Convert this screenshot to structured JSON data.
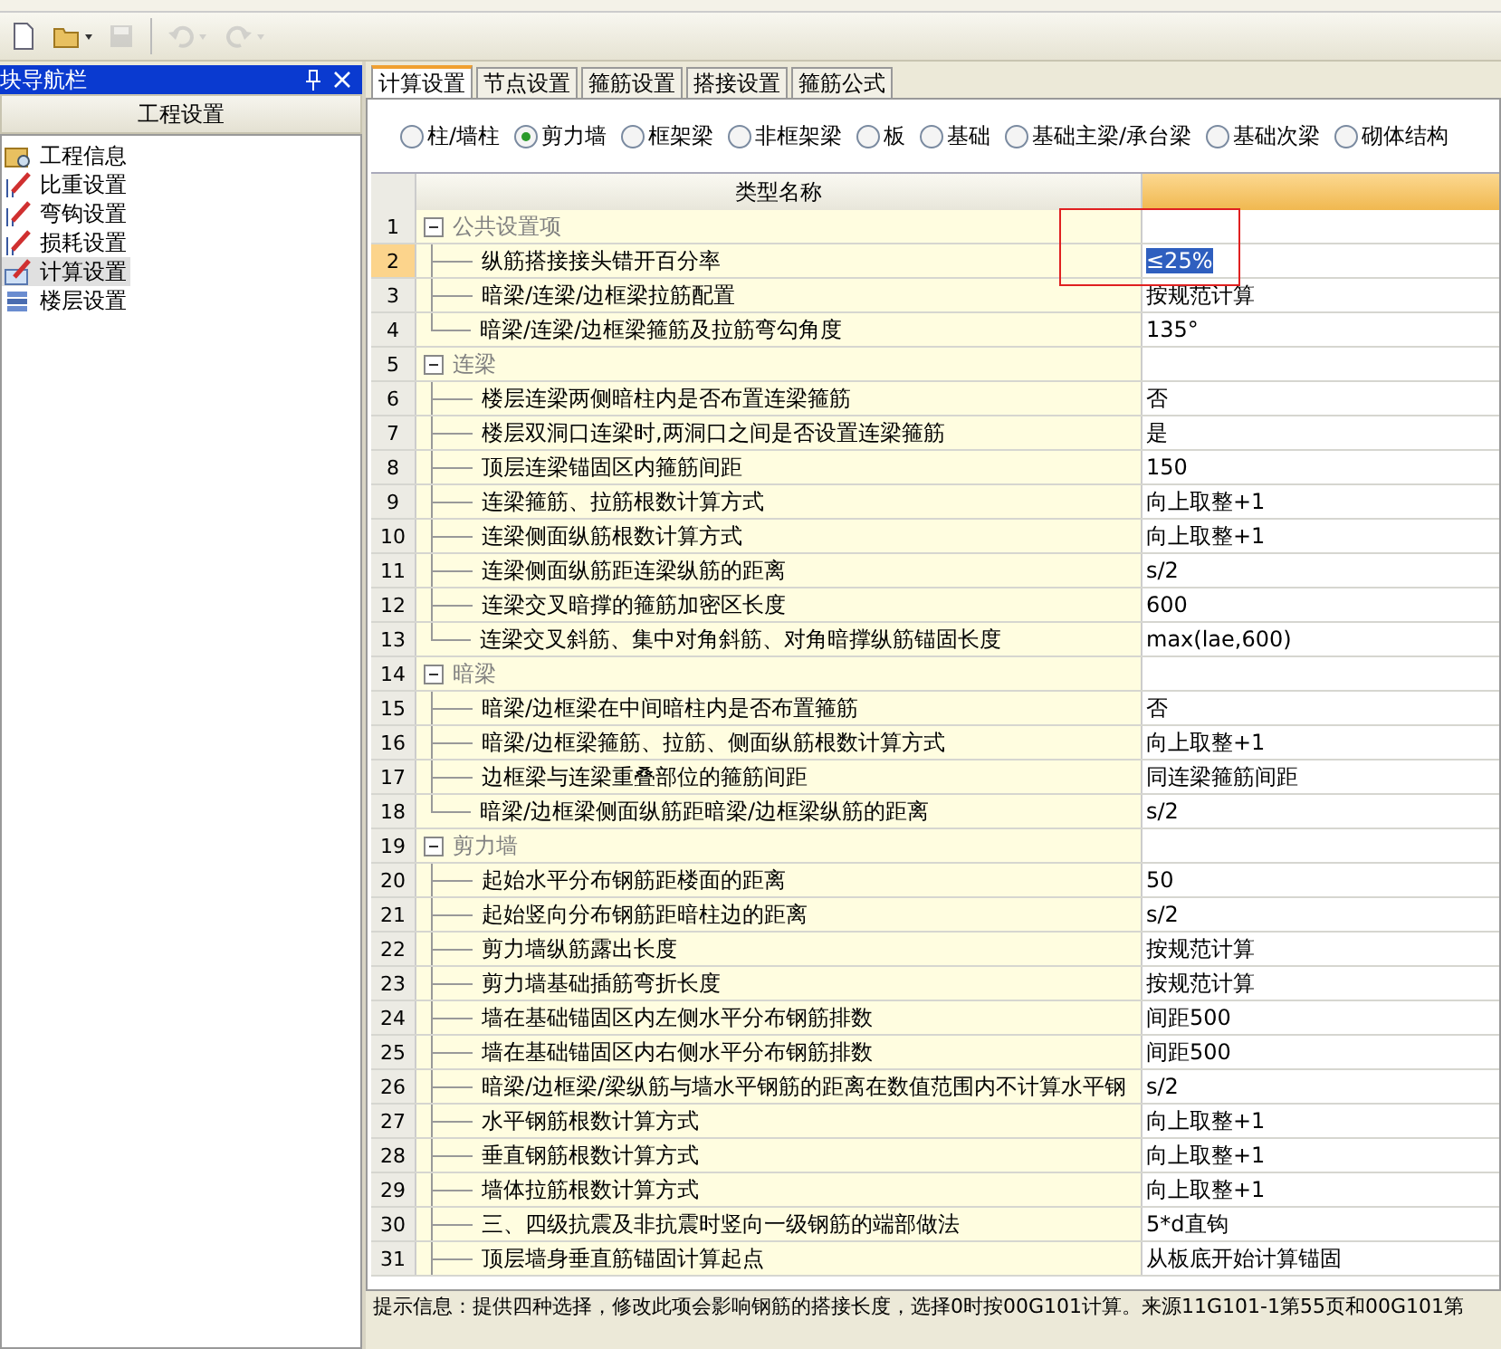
{
  "toolbar": {
    "buttons": [
      {
        "kind": "new",
        "disabled": false
      },
      {
        "kind": "open",
        "disabled": false
      },
      {
        "kind": "save",
        "disabled": true
      },
      {
        "kind": "undo",
        "disabled": true
      },
      {
        "kind": "redo",
        "disabled": true
      }
    ]
  },
  "sidebar": {
    "title": "块导航栏",
    "section": "工程设置",
    "items": [
      {
        "label": "工程信息",
        "kind": "info",
        "selected": false
      },
      {
        "label": "比重设置",
        "kind": "weight",
        "selected": false
      },
      {
        "label": "弯钩设置",
        "kind": "hook",
        "selected": false
      },
      {
        "label": "损耗设置",
        "kind": "loss",
        "selected": false
      },
      {
        "label": "计算设置",
        "kind": "calc",
        "selected": true
      },
      {
        "label": "楼层设置",
        "kind": "floor",
        "selected": false
      }
    ]
  },
  "tabs": [
    {
      "label": "计算设置",
      "selected": true
    },
    {
      "label": "节点设置",
      "selected": false
    },
    {
      "label": "箍筋设置",
      "selected": false
    },
    {
      "label": "搭接设置",
      "selected": false
    },
    {
      "label": "箍筋公式",
      "selected": false
    }
  ],
  "radios": [
    {
      "label": "柱/墙柱",
      "selected": false
    },
    {
      "label": "剪力墙",
      "selected": true
    },
    {
      "label": "框架梁",
      "selected": false
    },
    {
      "label": "非框架梁",
      "selected": false
    },
    {
      "label": "板",
      "selected": false
    },
    {
      "label": "基础",
      "selected": false
    },
    {
      "label": "基础主梁/承台梁",
      "selected": false
    },
    {
      "label": "基础次梁",
      "selected": false
    },
    {
      "label": "砌体结构",
      "selected": false
    }
  ],
  "table": {
    "columns": [
      "类型名称"
    ],
    "rows": [
      {
        "kind": "group",
        "num": "1",
        "name": "公共设置项",
        "expanded": true,
        "selected": false
      },
      {
        "kind": "item",
        "num": "2",
        "name": "纵筋搭接接头错开百分率",
        "value": "≤25%",
        "selected": true
      },
      {
        "kind": "item",
        "num": "3",
        "name": "暗梁/连梁/边框梁拉筋配置",
        "value": "按规范计算",
        "selected": false
      },
      {
        "kind": "item",
        "num": "4",
        "name": "暗梁/连梁/边框梁箍筋及拉筋弯勾角度",
        "value": "135°",
        "selected": false
      },
      {
        "kind": "group",
        "num": "5",
        "name": "连梁",
        "expanded": true,
        "selected": false
      },
      {
        "kind": "item",
        "num": "6",
        "name": "楼层连梁两侧暗柱内是否布置连梁箍筋",
        "value": "否",
        "selected": false
      },
      {
        "kind": "item",
        "num": "7",
        "name": "楼层双洞口连梁时,两洞口之间是否设置连梁箍筋",
        "value": "是",
        "selected": false
      },
      {
        "kind": "item",
        "num": "8",
        "name": "顶层连梁锚固区内箍筋间距",
        "value": "150",
        "selected": false
      },
      {
        "kind": "item",
        "num": "9",
        "name": "连梁箍筋、拉筋根数计算方式",
        "value": "向上取整+1",
        "selected": false
      },
      {
        "kind": "item",
        "num": "10",
        "name": "连梁侧面纵筋根数计算方式",
        "value": "向上取整+1",
        "selected": false
      },
      {
        "kind": "item",
        "num": "11",
        "name": "连梁侧面纵筋距连梁纵筋的距离",
        "value": "s/2",
        "selected": false
      },
      {
        "kind": "item",
        "num": "12",
        "name": "连梁交叉暗撑的箍筋加密区长度",
        "value": "600",
        "selected": false
      },
      {
        "kind": "item",
        "num": "13",
        "name": "连梁交叉斜筋、集中对角斜筋、对角暗撑纵筋锚固长度",
        "value": "max(lae,600)",
        "selected": false
      },
      {
        "kind": "group",
        "num": "14",
        "name": "暗梁",
        "expanded": true,
        "selected": false
      },
      {
        "kind": "item",
        "num": "15",
        "name": "暗梁/边框梁在中间暗柱内是否布置箍筋",
        "value": "否",
        "selected": false
      },
      {
        "kind": "item",
        "num": "16",
        "name": "暗梁/边框梁箍筋、拉筋、侧面纵筋根数计算方式",
        "value": "向上取整+1",
        "selected": false
      },
      {
        "kind": "item",
        "num": "17",
        "name": "边框梁与连梁重叠部位的箍筋间距",
        "value": "同连梁箍筋间距",
        "selected": false
      },
      {
        "kind": "item",
        "num": "18",
        "name": "暗梁/边框梁侧面纵筋距暗梁/边框梁纵筋的距离",
        "value": "s/2",
        "selected": false
      },
      {
        "kind": "group",
        "num": "19",
        "name": "剪力墙",
        "expanded": true,
        "selected": false
      },
      {
        "kind": "item",
        "num": "20",
        "name": "起始水平分布钢筋距楼面的距离",
        "value": "50",
        "selected": false
      },
      {
        "kind": "item",
        "num": "21",
        "name": "起始竖向分布钢筋距暗柱边的距离",
        "value": "s/2",
        "selected": false
      },
      {
        "kind": "item",
        "num": "22",
        "name": "剪力墙纵筋露出长度",
        "value": "按规范计算",
        "selected": false
      },
      {
        "kind": "item",
        "num": "23",
        "name": "剪力墙基础插筋弯折长度",
        "value": "按规范计算",
        "selected": false
      },
      {
        "kind": "item",
        "num": "24",
        "name": "墙在基础锚固区内左侧水平分布钢筋排数",
        "value": "间距500",
        "selected": false
      },
      {
        "kind": "item",
        "num": "25",
        "name": "墙在基础锚固区内右侧水平分布钢筋排数",
        "value": "间距500",
        "selected": false
      },
      {
        "kind": "item",
        "num": "26",
        "name": "暗梁/边框梁/梁纵筋与墙水平钢筋的距离在数值范围内不计算水平钢",
        "value": "s/2",
        "selected": false
      },
      {
        "kind": "item",
        "num": "27",
        "name": "水平钢筋根数计算方式",
        "value": "向上取整+1",
        "selected": false
      },
      {
        "kind": "item",
        "num": "28",
        "name": "垂直钢筋根数计算方式",
        "value": "向上取整+1",
        "selected": false
      },
      {
        "kind": "item",
        "num": "29",
        "name": "墙体拉筋根数计算方式",
        "value": "向上取整+1",
        "selected": false
      },
      {
        "kind": "item",
        "num": "30",
        "name": "三、四级抗震及非抗震时竖向一级钢筋的端部做法",
        "value": "5*d直钩",
        "selected": false
      },
      {
        "kind": "item",
        "num": "31",
        "name": "顶层墙身垂直筋锚固计算起点",
        "value": "从板底开始计算锚固",
        "selected": false
      }
    ]
  },
  "status_bar": "提示信息：提供四种选择，修改此项会影响钢筋的搭接长度，选择0时按00G101计算。来源11G101-1第55页和00G101第"
}
